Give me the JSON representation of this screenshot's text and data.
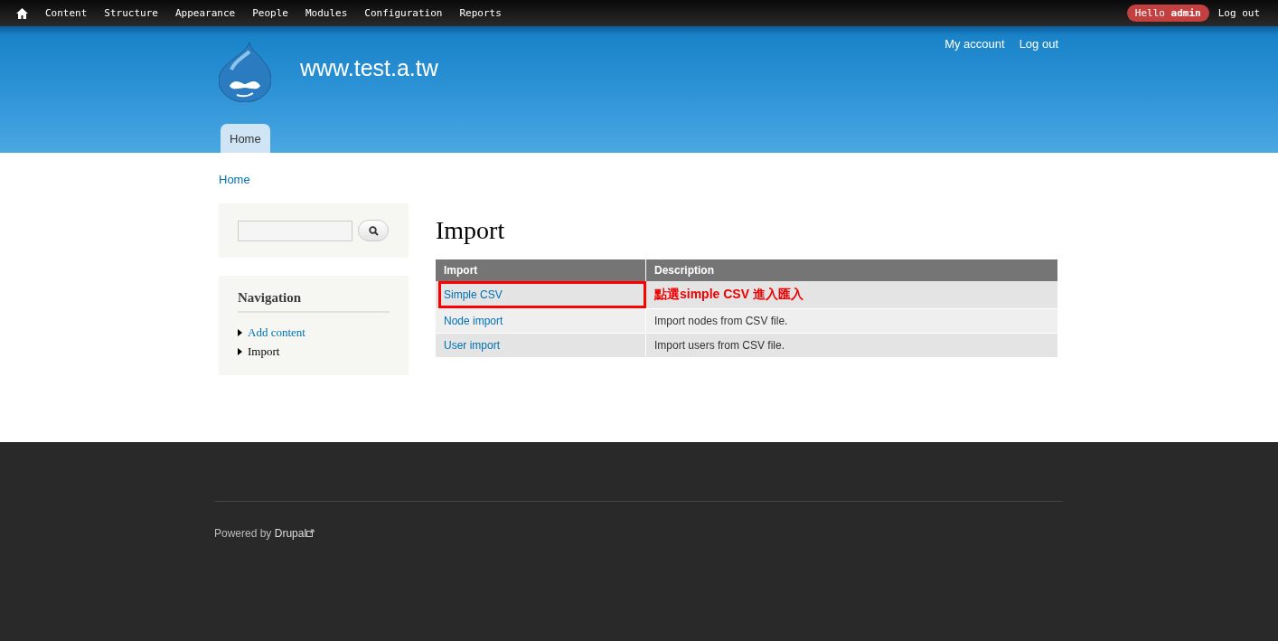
{
  "toolbar": {
    "items": [
      "Content",
      "Structure",
      "Appearance",
      "People",
      "Modules",
      "Configuration",
      "Reports"
    ],
    "greeting": "Hello **admin**",
    "logout": "Log out"
  },
  "header": {
    "site_name": "www.test.a.tw",
    "secondary_menu": [
      "My account",
      "Log out"
    ],
    "tabs": [
      {
        "label": "Home",
        "selected": true
      }
    ]
  },
  "breadcrumb": [
    "Home"
  ],
  "sidebar": {
    "navigation": {
      "title": "Navigation",
      "items": [
        {
          "label": "Add content",
          "selected": false
        },
        {
          "label": "Import",
          "selected": true
        }
      ]
    }
  },
  "main": {
    "title": "Import",
    "table": {
      "columns": [
        "Import",
        "Description"
      ],
      "rows": [
        {
          "name": "Simple CSV",
          "description": "點選simple CSV 進入匯入",
          "kind": "annotation",
          "highlighted": true
        },
        {
          "name": "Node import",
          "description": "Import nodes from CSV file.",
          "kind": "plain",
          "highlighted": false
        },
        {
          "name": "User import",
          "description": "Import users from CSV file.",
          "kind": "plain",
          "highlighted": false
        }
      ]
    }
  },
  "footer": {
    "prefix": "Powered by",
    "link": "Drupal"
  }
}
